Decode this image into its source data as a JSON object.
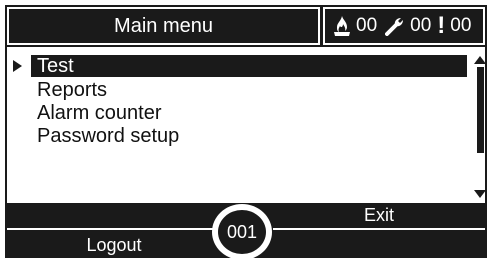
{
  "header": {
    "title": "Main menu",
    "status": {
      "fire_icon": "fire-icon",
      "fire_count": "00",
      "fault_icon": "wrench-icon",
      "fault_count": "00",
      "warning_icon": "exclamation-icon",
      "warning_symbol": "!",
      "warning_count": "00"
    }
  },
  "menu": {
    "cursor_icon": "triangle-right-icon",
    "items": [
      {
        "label": "Test",
        "selected": true
      },
      {
        "label": "Reports",
        "selected": false
      },
      {
        "label": "Alarm counter",
        "selected": false
      },
      {
        "label": "Password setup",
        "selected": false
      }
    ]
  },
  "scrollbar": {
    "up_icon": "triangle-up-icon",
    "down_icon": "triangle-down-icon"
  },
  "footer": {
    "left_label": "Logout",
    "right_label": "Exit",
    "counter_value": "001"
  },
  "colors": {
    "foreground": "#1a1a1a",
    "background": "#ffffff"
  }
}
